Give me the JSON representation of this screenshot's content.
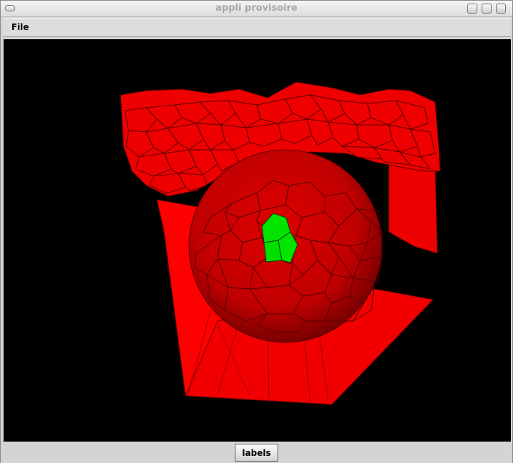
{
  "window": {
    "title": "appli provisoire"
  },
  "menubar": {
    "items": [
      {
        "label": "File"
      }
    ]
  },
  "viewport": {
    "background": "#000000",
    "mesh_color": "#ff0000",
    "edge_color": "#5a0000",
    "highlight_color": "#00e000"
  },
  "footer": {
    "labels_button": "labels"
  }
}
